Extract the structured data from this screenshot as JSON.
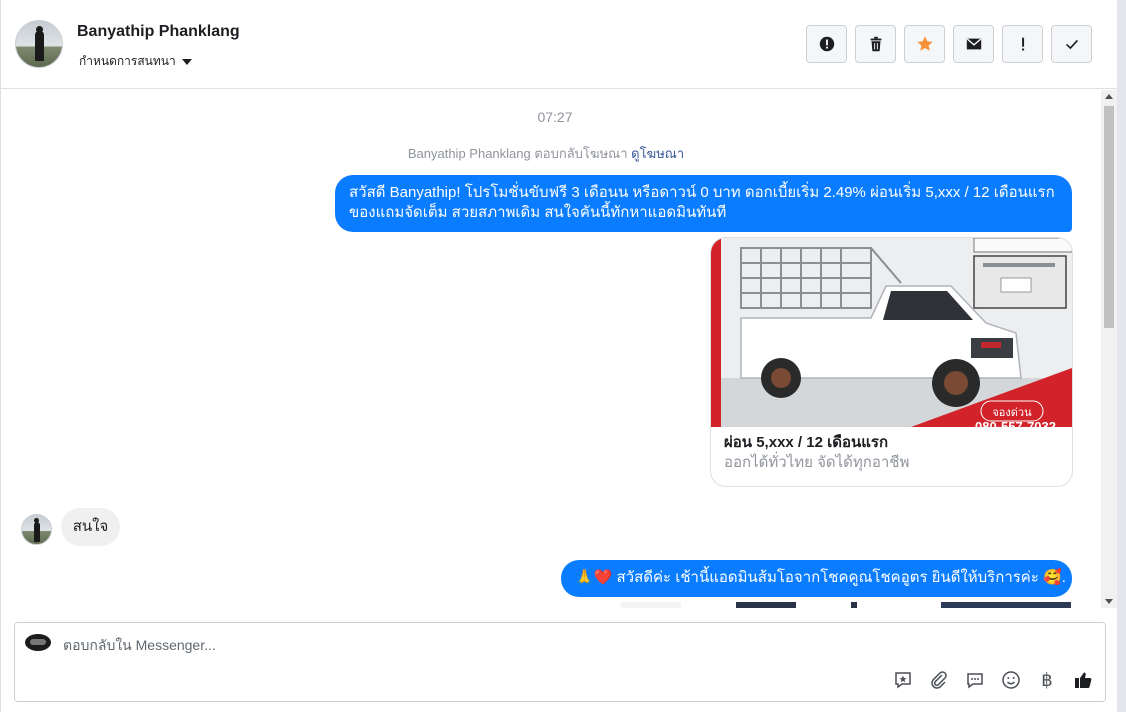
{
  "header": {
    "contact_name": "Banyathip Phanklang",
    "thread_label": "กำหนดการสนทนา"
  },
  "toolbar": {
    "buttons": [
      {
        "icon": "alert-circle-icon"
      },
      {
        "icon": "trash-icon"
      },
      {
        "icon": "star-icon",
        "color": "#f7923a"
      },
      {
        "icon": "envelope-icon"
      },
      {
        "icon": "exclamation-icon"
      },
      {
        "icon": "checkmark-icon"
      }
    ]
  },
  "conversation": {
    "timestamp": "07:27",
    "ad_reply_prefix": "Banyathip Phanklang ตอบกลับโฆษณา",
    "ad_reply_link": "ดูโฆษณา",
    "message_1": "สวัสดี Banyathip! โปรโมชั่นขับฟรี 3 เดือนน หรือดาวน์ 0 บาท ดอกเบี้ยเริ่ม 2.49% ผ่อนเริ่ม 5,xxx / 12 เดือนแรก ของแถมจัดเต็ม สวยสภาพเดิม สนใจคันนี้ทักหาแอดมินทันที",
    "ad_card": {
      "title": "ผ่อน 5,xxx / 12 เดือนแรก",
      "subtitle": "ออกได้ทั่วไทย จัดได้ทุกอาชีพ",
      "image_badge": "จองด่วน",
      "image_phone": "080-557-7032"
    },
    "message_2": "สนใจ",
    "message_3": "🙏❤️ สวัสดีค่ะ เช้านี้แอดมินส้มโอจากโชคคูณโชคอูตร ยินดีให้บริการค่ะ 🥰."
  },
  "composer": {
    "placeholder": "ตอบกลับใน Messenger...",
    "icons": [
      "saved-reply-icon",
      "paperclip-icon",
      "chat-bubble-icon",
      "emoji-icon",
      "baht-icon",
      "thumbs-up-icon"
    ],
    "baht_symbol": "฿"
  },
  "colors": {
    "outgoing_bubble": "#0a7cff",
    "incoming_bubble": "#f1f0f0",
    "link": "#385898",
    "star": "#f7923a"
  }
}
